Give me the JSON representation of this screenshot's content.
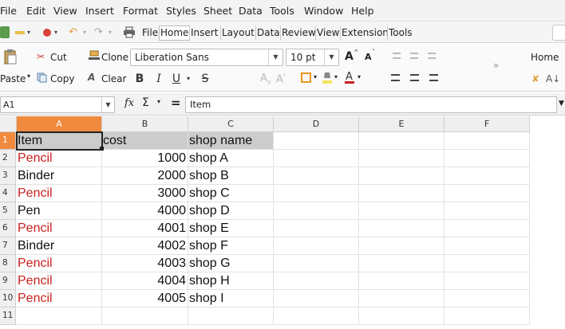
{
  "menu": [
    "File",
    "Edit",
    "View",
    "Insert",
    "Format",
    "Styles",
    "Sheet",
    "Data",
    "Tools",
    "Window",
    "Help"
  ],
  "tabs": [
    "File",
    "Home",
    "Insert",
    "Layout",
    "Data",
    "Review",
    "View",
    "Extension",
    "Tools"
  ],
  "active_tab": "Home",
  "ribbon": {
    "paste": "Paste",
    "cut": "Cut",
    "copy": "Copy",
    "clone": "Clone",
    "clear": "Clear",
    "font_name": "Liberation Sans",
    "font_size": "10 pt",
    "bold": "B",
    "italic": "I",
    "underline": "U",
    "strikethrough": "S",
    "grow_font": "A",
    "shrink_font": "A",
    "home_label": "Home",
    "overflow": "»"
  },
  "formula_bar": {
    "name_box": "A1",
    "fx": "fx",
    "sum": "Σ",
    "equals": "=",
    "content": "Item"
  },
  "columns": [
    "A",
    "B",
    "C",
    "D",
    "E",
    "F"
  ],
  "selected_column": "A",
  "rows": [
    {
      "num": "1",
      "a": "Item",
      "b": "cost",
      "c": "shop name",
      "header": true
    },
    {
      "num": "2",
      "a": "Pencil",
      "b": "1000",
      "c": "shop A",
      "red": true
    },
    {
      "num": "3",
      "a": "Binder",
      "b": "2000",
      "c": "shop B",
      "red": false
    },
    {
      "num": "4",
      "a": "Pencil",
      "b": "3000",
      "c": "shop C",
      "red": true
    },
    {
      "num": "5",
      "a": "Pen",
      "b": "4000",
      "c": "shop D",
      "red": false
    },
    {
      "num": "6",
      "a": "Pencil",
      "b": "4001",
      "c": "shop E",
      "red": true
    },
    {
      "num": "7",
      "a": "Binder",
      "b": "4002",
      "c": "shop F",
      "red": false
    },
    {
      "num": "8",
      "a": "Pencil",
      "b": "4003",
      "c": "shop G",
      "red": true
    },
    {
      "num": "9",
      "a": "Pencil",
      "b": "4004",
      "c": "shop H",
      "red": true
    },
    {
      "num": "10",
      "a": "Pencil",
      "b": "4005",
      "c": "shop I",
      "red": true
    },
    {
      "num": "11",
      "a": "",
      "b": "",
      "c": "",
      "red": false
    }
  ],
  "colors": {
    "accent": "#f08a3e",
    "red_text": "#c9211e",
    "header_fill": "#cccccc"
  }
}
